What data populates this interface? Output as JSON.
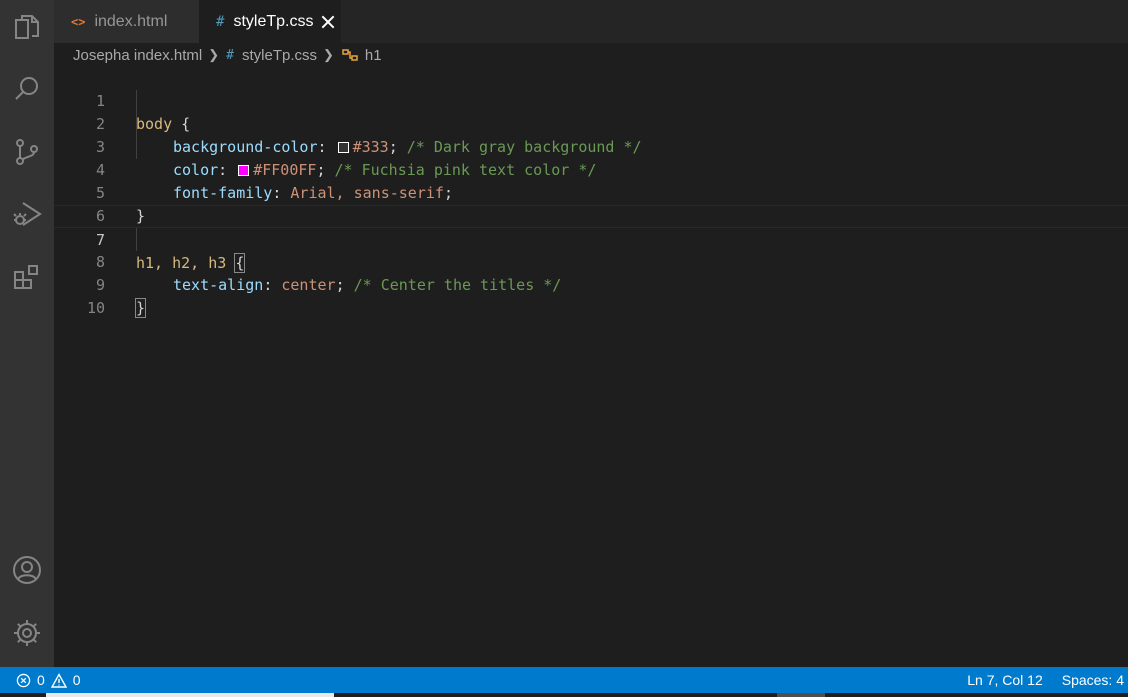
{
  "tabs": [
    {
      "icon": "<>",
      "label": "index.html"
    },
    {
      "icon": "#",
      "label": "styleTp.css"
    }
  ],
  "breadcrumb": {
    "folder": "Josepha index.html",
    "file_icon": "#",
    "file": "styleTp.css",
    "symbol": "h1"
  },
  "lines": {
    "n1": "1",
    "n2": "2",
    "n3": "3",
    "n4": "4",
    "n5": "5",
    "n6": "6",
    "n7": "7",
    "n8": "8",
    "n9": "9",
    "n10": "10"
  },
  "code": {
    "l1_sel": "body",
    "l1_brace": " {",
    "l2_prop": "background-color",
    "l2_colon": ": ",
    "l2_val": "#333",
    "l2_semi": "; ",
    "l2_cmt": "/* Dark gray background */",
    "l3_prop": "color",
    "l3_colon": ": ",
    "l3_val": "#FF00FF",
    "l3_semi": "; ",
    "l3_cmt": "/* Fuchsia pink text color */",
    "l4_prop": "font-family",
    "l4_colon": ": ",
    "l4_val": "Arial, sans-serif",
    "l4_semi": ";",
    "l5": "}",
    "l7_sel": "h1, h2, h3 ",
    "l7_brace": "{",
    "l8_prop": "text-align",
    "l8_colon": ": ",
    "l8_val": "center",
    "l8_semi": "; ",
    "l8_cmt": "/* Center the titles */",
    "l9": "}"
  },
  "swatches": {
    "gray": "#333333",
    "fuchsia": "#FF00FF"
  },
  "status": {
    "errors": "0",
    "warnings": "0",
    "position": "Ln 7, Col 12",
    "spaces": "Spaces: 4"
  },
  "colors": {
    "statusbar": "#007acc",
    "activity_bar": "#333333",
    "editor_bg": "#1e1e1e"
  }
}
